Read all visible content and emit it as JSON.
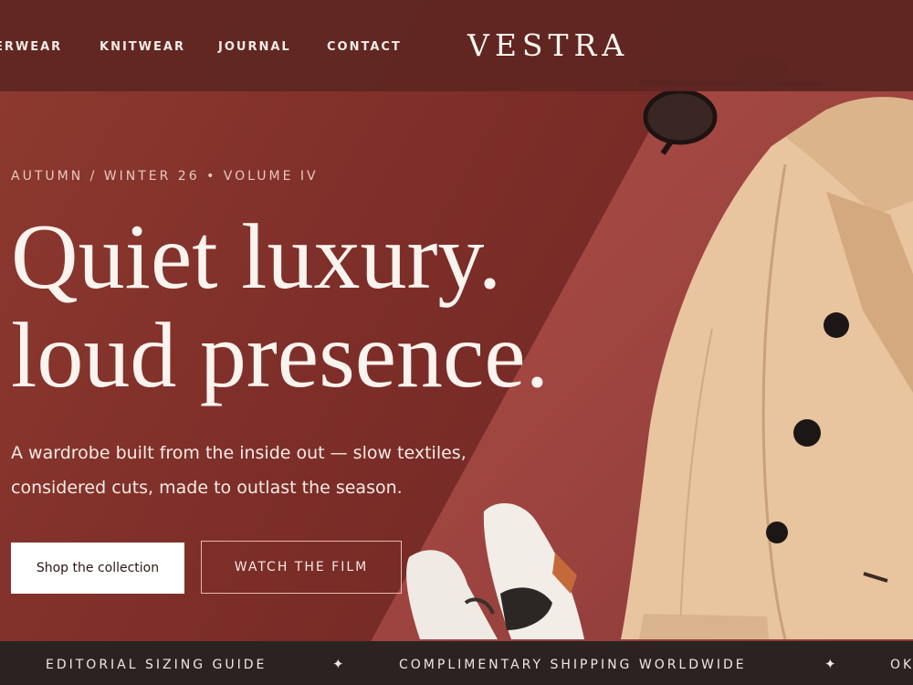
{
  "nav": {
    "links": [
      "ERWEAR",
      "KNITWEAR",
      "JOURNAL",
      "CONTACT"
    ],
    "brand": "VESTRA"
  },
  "hero": {
    "eyebrow": "AUTUMN / WINTER 26 • VOLUME IV",
    "headline_line1": "Quiet luxury.",
    "headline_line2": "loud presence.",
    "subtitle": "A wardrobe built from the inside out — slow textiles, considered cuts, made to outlast the season.",
    "primary_cta": "Shop the collection",
    "secondary_cta": "WATCH THE FILM"
  },
  "ticker": {
    "items": [
      "EDITORIAL SIZING GUIDE",
      "COMPLIMENTARY SHIPPING WORLDWIDE",
      "OK"
    ],
    "separator": "✦"
  },
  "colors": {
    "hero_background": "#7c2d28",
    "nav_background": "#5e2622",
    "ticker_background": "#2b2322",
    "coat": "#e7c39f"
  },
  "images": {
    "hero_photo": "coat-sunglasses-loafers-photo"
  }
}
